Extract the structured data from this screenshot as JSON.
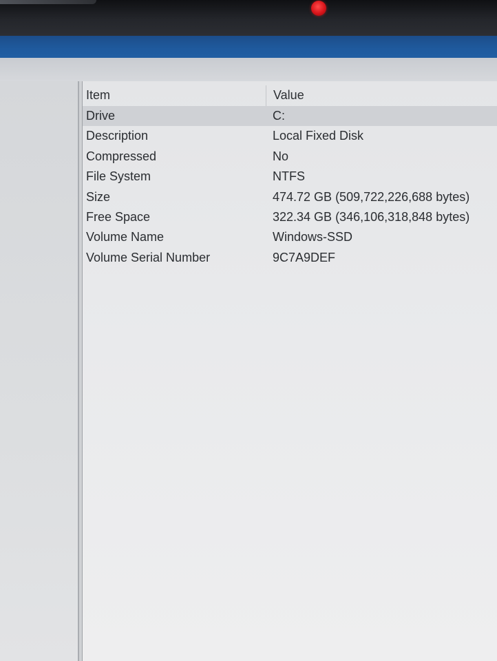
{
  "list": {
    "columns": {
      "item": "Item",
      "value": "Value"
    },
    "rows": [
      {
        "item": "Drive",
        "value": "C:"
      },
      {
        "item": "Description",
        "value": "Local Fixed Disk"
      },
      {
        "item": "Compressed",
        "value": "No"
      },
      {
        "item": "File System",
        "value": "NTFS"
      },
      {
        "item": "Size",
        "value": "474.72 GB (509,722,226,688 bytes)"
      },
      {
        "item": "Free Space",
        "value": "322.34 GB (346,106,318,848 bytes)"
      },
      {
        "item": "Volume Name",
        "value": "Windows-SSD"
      },
      {
        "item": "Volume Serial Number",
        "value": "9C7A9DEF"
      }
    ],
    "selected_row": "Drive"
  },
  "colors": {
    "title_bar": "#1f5a9e",
    "selection": "#cfd1d5",
    "camera_led": "#d8141a"
  }
}
